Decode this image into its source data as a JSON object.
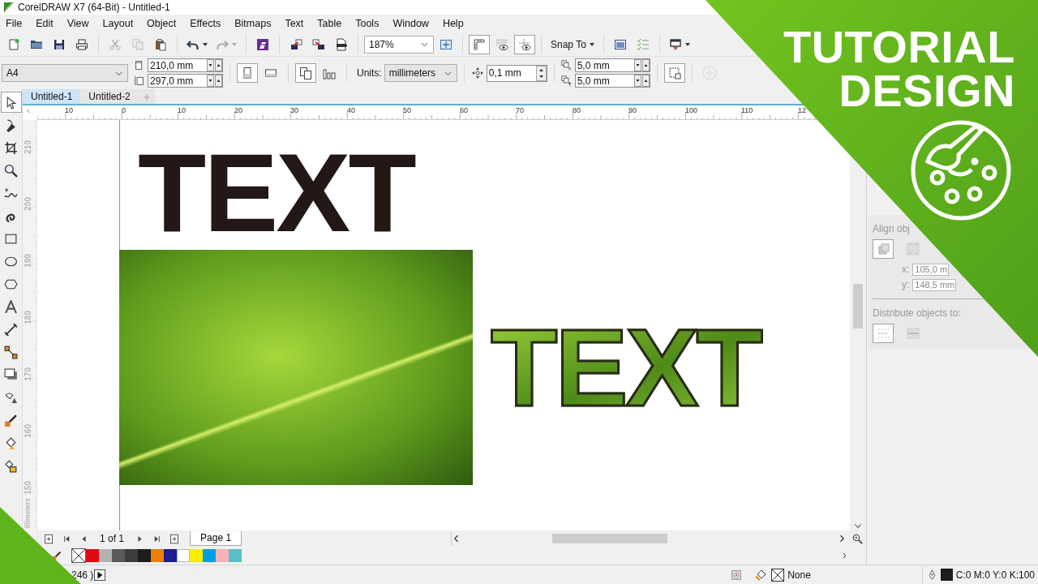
{
  "title_bar": {
    "title": "CorelDRAW X7 (64-Bit) - Untitled-1"
  },
  "menu": [
    {
      "label": "File"
    },
    {
      "label": "Edit"
    },
    {
      "label": "View"
    },
    {
      "label": "Layout"
    },
    {
      "label": "Object"
    },
    {
      "label": "Effects"
    },
    {
      "label": "Bitmaps"
    },
    {
      "label": "Text"
    },
    {
      "label": "Table"
    },
    {
      "label": "Tools"
    },
    {
      "label": "Window"
    },
    {
      "label": "Help"
    }
  ],
  "toolbar": {
    "zoom_level": "187%",
    "snap_to": "Snap To",
    "buttons": [
      {
        "disabled": false,
        "pressed": false
      },
      {
        "disabled": false,
        "pressed": false
      },
      {
        "disabled": false,
        "pressed": false
      },
      {
        "disabled": false,
        "pressed": false
      },
      {
        "disabled": true,
        "pressed": false
      },
      {
        "disabled": true,
        "pressed": false
      },
      {
        "disabled": false,
        "pressed": false
      },
      {
        "disabled": false,
        "pressed": false
      },
      {
        "disabled": true,
        "pressed": false
      },
      {
        "disabled": false,
        "pressed": false
      },
      {
        "disabled": false,
        "pressed": false
      },
      {
        "disabled": false,
        "pressed": false
      },
      {
        "disabled": false,
        "pressed": false
      },
      {
        "disabled": false,
        "pressed": false
      },
      {
        "disabled": false,
        "pressed": true
      },
      {
        "disabled": false,
        "pressed": false
      },
      {
        "disabled": false,
        "pressed": true
      },
      {
        "disabled": false,
        "pressed": false
      },
      {
        "disabled": false,
        "pressed": false
      },
      {
        "disabled": false,
        "pressed": false
      }
    ]
  },
  "property_bar": {
    "page_size": "A4",
    "width": "210,0 mm",
    "height": "297,0 mm",
    "orientation_buttons": [
      {
        "selected": true
      },
      {
        "selected": false
      }
    ],
    "page_scope_buttons": [
      {
        "selected": true
      },
      {
        "selected": false
      }
    ],
    "units_label": "Units:",
    "units": "millimeters",
    "nudge": "0,1 mm",
    "duplicate_x": "5,0 mm",
    "duplicate_y": "5,0 mm",
    "treat_as_filled": {
      "pressed": true
    },
    "add_preset": {
      "disabled": true
    }
  },
  "document_tabs": [
    {
      "label": "Untitled-1",
      "selected": true
    },
    {
      "label": "Untitled-2",
      "selected": false
    }
  ],
  "toolbox": [
    {
      "selected": true
    },
    {
      "selected": false
    },
    {
      "selected": false
    },
    {
      "selected": false
    },
    {
      "selected": false
    },
    {
      "selected": false
    },
    {
      "selected": false
    },
    {
      "selected": false
    },
    {
      "selected": false
    },
    {
      "selected": false
    },
    {
      "selected": false
    },
    {
      "selected": false
    },
    {
      "selected": false
    },
    {
      "selected": false
    },
    {
      "selected": false
    },
    {
      "selected": false
    },
    {
      "selected": false
    }
  ],
  "rulers": {
    "horizontal": [
      "10",
      "0",
      "10",
      "20",
      "30",
      "40",
      "50",
      "60",
      "70",
      "80",
      "90",
      "100",
      "110",
      "12"
    ],
    "vertical": [
      "210",
      "200",
      "190",
      "180",
      "170",
      "160",
      "150"
    ],
    "unit_label": "illimeters"
  },
  "canvas": {
    "objects": [
      {
        "kind": "solid_text",
        "text": "TEXT"
      },
      {
        "kind": "photo"
      },
      {
        "kind": "image_text",
        "text": "TEXT"
      }
    ]
  },
  "page_nav": {
    "counter": "1 of 1",
    "pages": [
      {
        "label": "Page 1",
        "selected": true
      }
    ]
  },
  "palette": [
    {
      "kind": "none"
    },
    {
      "kind": "swatch",
      "color": "#e30613"
    },
    {
      "kind": "swatch",
      "color": "#b2b2b2"
    },
    {
      "kind": "swatch",
      "color": "#5a5a5a"
    },
    {
      "kind": "swatch",
      "color": "#3c3c3b"
    },
    {
      "kind": "swatch",
      "color": "#1d1d1b"
    },
    {
      "kind": "swatch",
      "color": "#ef7d00"
    },
    {
      "kind": "swatch",
      "color": "#1d1d8f"
    },
    {
      "kind": "swatch",
      "color": "#ffffff"
    },
    {
      "kind": "swatch",
      "color": "#ffed00"
    },
    {
      "kind": "swatch",
      "color": "#009fe3"
    },
    {
      "kind": "swatch",
      "color": "#f5b5b8"
    },
    {
      "kind": "swatch",
      "color": "#59bfc8"
    }
  ],
  "docker": {
    "disabled": true,
    "align_heading": "Align obj",
    "x_label": "x:",
    "x_value": "105,0 m",
    "y_label": "y:",
    "y_value": "148,5 mm",
    "distribute_heading": "Distribute objects to:"
  },
  "status_bar": {
    "info": "246 )",
    "fill": "None",
    "outline": "C:0 M:0 Y:0 K:100"
  },
  "banner": {
    "lines": [
      "TUTORIAL",
      "DESIGN"
    ]
  }
}
